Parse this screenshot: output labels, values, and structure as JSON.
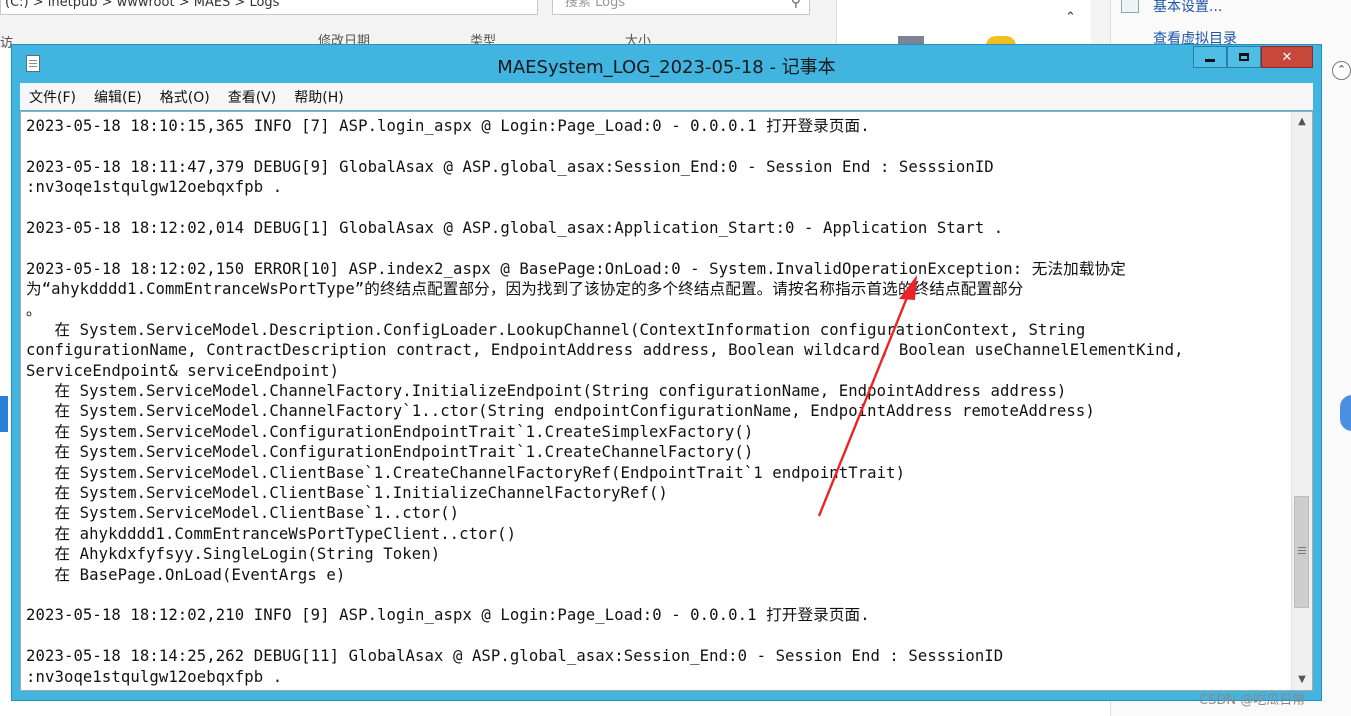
{
  "background": {
    "address_text": "(C:)  >  inetpub  >  wwwroot  >  MAES  >  Logs",
    "search_placeholder": "搜索 Logs",
    "col_modified": "修改日期",
    "col_type": "类型",
    "col_size": "大小",
    "left_nav_text": "访",
    "right_link_1": "基本设置...",
    "right_link_2": "查看虚拟目录"
  },
  "notepad": {
    "title": "MAESystem_LOG_2023-05-18 - 记事本",
    "menu": [
      "文件(F)",
      "编辑(E)",
      "格式(O)",
      "查看(V)",
      "帮助(H)"
    ],
    "controls": {
      "minimize": "minimize",
      "maximize": "maximize",
      "close": "close"
    },
    "lines": [
      "2023-05-18 18:10:15,365 INFO [7] ASP.login_aspx @ Login:Page_Load:0 - 0.0.0.1 打开登录页面.",
      "",
      "2023-05-18 18:11:47,379 DEBUG[9] GlobalAsax @ ASP.global_asax:Session_End:0 - Session End : SesssionID",
      ":nv3oqe1stqulgw12oebqxfpb .",
      "",
      "2023-05-18 18:12:02,014 DEBUG[1] GlobalAsax @ ASP.global_asax:Application_Start:0 - Application Start .",
      "",
      "2023-05-18 18:12:02,150 ERROR[10] ASP.index2_aspx @ BasePage:OnLoad:0 - System.InvalidOperationException: 无法加载协定",
      "为“ahykdddd1.CommEntranceWsPortType”的终结点配置部分，因为找到了该协定的多个终结点配置。请按名称指示首选的终结点配置部分",
      "。",
      "   在 System.ServiceModel.Description.ConfigLoader.LookupChannel(ContextInformation configurationContext, String",
      "configurationName, ContractDescription contract, EndpointAddress address, Boolean wildcard, Boolean useChannelElementKind,",
      "ServiceEndpoint& serviceEndpoint)",
      "   在 System.ServiceModel.ChannelFactory.InitializeEndpoint(String configurationName, EndpointAddress address)",
      "   在 System.ServiceModel.ChannelFactory`1..ctor(String endpointConfigurationName, EndpointAddress remoteAddress)",
      "   在 System.ServiceModel.ConfigurationEndpointTrait`1.CreateSimplexFactory()",
      "   在 System.ServiceModel.ConfigurationEndpointTrait`1.CreateChannelFactory()",
      "   在 System.ServiceModel.ClientBase`1.CreateChannelFactoryRef(EndpointTrait`1 endpointTrait)",
      "   在 System.ServiceModel.ClientBase`1.InitializeChannelFactoryRef()",
      "   在 System.ServiceModel.ClientBase`1..ctor()",
      "   在 ahykdddd1.CommEntranceWsPortTypeClient..ctor()",
      "   在 Ahykdxfyfsyy.SingleLogin(String Token)",
      "   在 BasePage.OnLoad(EventArgs e)",
      "",
      "2023-05-18 18:12:02,210 INFO [9] ASP.login_aspx @ Login:Page_Load:0 - 0.0.0.1 打开登录页面.",
      "",
      "2023-05-18 18:14:25,262 DEBUG[11] GlobalAsax @ ASP.global_asax:Session_End:0 - Session End : SesssionID",
      ":nv3oqe1stqulgw12oebqxfpb ."
    ]
  },
  "annotation": {
    "arrow_color": "#e8262a"
  },
  "watermark": "CSDN @吃瓜日常"
}
